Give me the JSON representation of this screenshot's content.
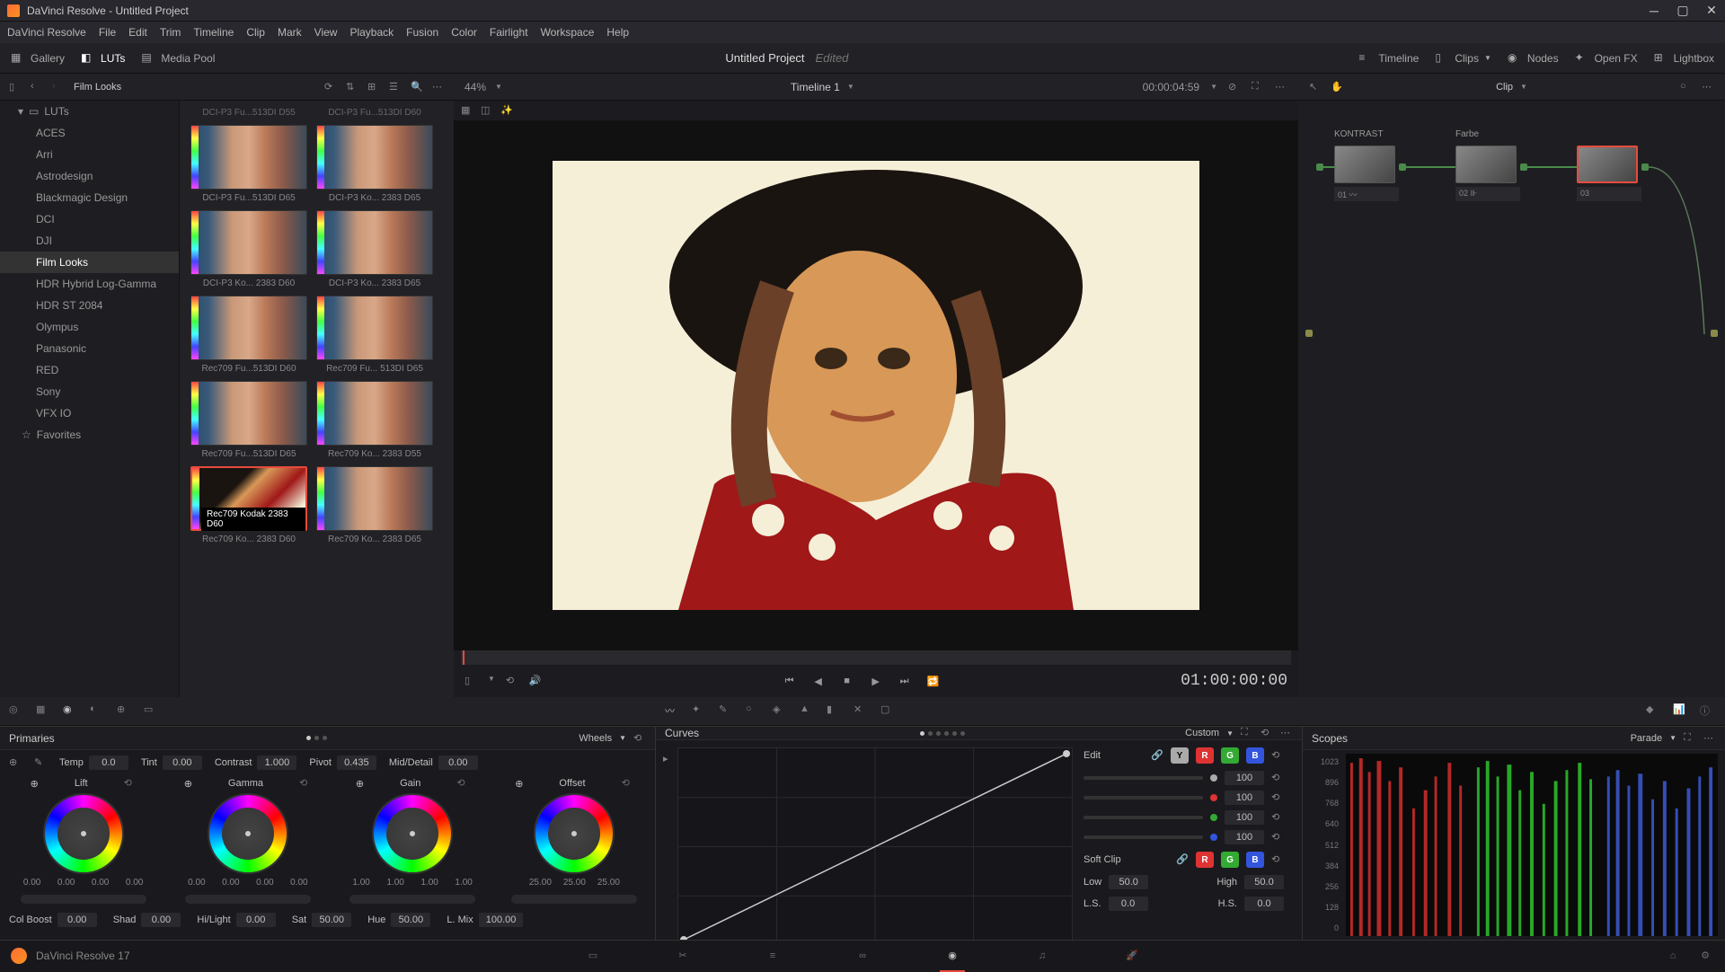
{
  "titlebar": {
    "text": "DaVinci Resolve - Untitled Project"
  },
  "menu": [
    "DaVinci Resolve",
    "File",
    "Edit",
    "Trim",
    "Timeline",
    "Clip",
    "Mark",
    "View",
    "Playback",
    "Fusion",
    "Color",
    "Fairlight",
    "Workspace",
    "Help"
  ],
  "toolbar": {
    "gallery": "Gallery",
    "luts": "LUTs",
    "mediapool": "Media Pool",
    "project_title": "Untitled Project",
    "project_status": "Edited",
    "timeline": "Timeline",
    "clips": "Clips",
    "nodes": "Nodes",
    "openfx": "Open FX",
    "lightbox": "Lightbox"
  },
  "toolbar2": {
    "panel_title": "Film Looks",
    "zoom": "44%",
    "timeline_name": "Timeline 1",
    "timecode": "00:00:04:59",
    "clip_label": "Clip"
  },
  "lut_tree": {
    "root": "LUTs",
    "items": [
      "ACES",
      "Arri",
      "Astrodesign",
      "Blackmagic Design",
      "DCI",
      "DJI",
      "Film Looks",
      "HDR Hybrid Log-Gamma",
      "HDR ST 2084",
      "Olympus",
      "Panasonic",
      "RED",
      "Sony",
      "VFX IO",
      "Favorites"
    ],
    "selected": "Film Looks"
  },
  "lut_thumbs": [
    {
      "l": "DCI-P3 Fu...513DI D65",
      "r": "DCI-P3 Ko... 2383 D65"
    },
    {
      "l": "DCI-P3 Ko... 2383 D60",
      "r": "DCI-P3 Ko... 2383 D65"
    },
    {
      "l": "Rec709 Fu...513DI D60",
      "r": "Rec709 Fu... 513DI D65"
    },
    {
      "l": "Rec709 Fu...513DI D65",
      "r": "Rec709 Ko... 2383 D55"
    },
    {
      "l": "Rec709 Ko... 2383 D60",
      "r": "Rec709 Ko... 2383 D65",
      "sel": true,
      "tooltip": "Rec709 Kodak 2383 D60"
    }
  ],
  "prev_row": {
    "l": "DCI-P3 Fu...513DI D55",
    "r": "DCI-P3 Fu...513DI D60"
  },
  "viewer": {
    "timecode": "01:00:00:00"
  },
  "nodes": {
    "n1": {
      "label": "KONTRAST",
      "num": "01"
    },
    "n2": {
      "label": "Farbe",
      "num": "02"
    },
    "n3": {
      "num": "03"
    }
  },
  "primaries": {
    "title": "Primaries",
    "mode": "Wheels",
    "temp": {
      "label": "Temp",
      "val": "0.0"
    },
    "tint": {
      "label": "Tint",
      "val": "0.00"
    },
    "contrast": {
      "label": "Contrast",
      "val": "1.000"
    },
    "pivot": {
      "label": "Pivot",
      "val": "0.435"
    },
    "middetail": {
      "label": "Mid/Detail",
      "val": "0.00"
    },
    "wheels": {
      "lift": {
        "label": "Lift",
        "vals": [
          "0.00",
          "0.00",
          "0.00",
          "0.00"
        ]
      },
      "gamma": {
        "label": "Gamma",
        "vals": [
          "0.00",
          "0.00",
          "0.00",
          "0.00"
        ]
      },
      "gain": {
        "label": "Gain",
        "vals": [
          "1.00",
          "1.00",
          "1.00",
          "1.00"
        ]
      },
      "offset": {
        "label": "Offset",
        "vals": [
          "25.00",
          "25.00",
          "25.00"
        ]
      }
    },
    "row2": {
      "colboost": {
        "label": "Col Boost",
        "val": "0.00"
      },
      "shad": {
        "label": "Shad",
        "val": "0.00"
      },
      "hilight": {
        "label": "Hi/Light",
        "val": "0.00"
      },
      "sat": {
        "label": "Sat",
        "val": "50.00"
      },
      "hue": {
        "label": "Hue",
        "val": "50.00"
      },
      "lmix": {
        "label": "L. Mix",
        "val": "100.00"
      }
    }
  },
  "curves": {
    "title": "Curves",
    "mode": "Custom",
    "edit": "Edit",
    "softclip": "Soft Clip",
    "vals": [
      "100",
      "100",
      "100",
      "100"
    ],
    "low": {
      "label": "Low",
      "val": "50.0"
    },
    "high": {
      "label": "High",
      "val": "50.0"
    },
    "ls": {
      "label": "L.S.",
      "val": "0.0"
    },
    "hs": {
      "label": "H.S.",
      "val": "0.0"
    }
  },
  "scopes": {
    "title": "Scopes",
    "mode": "Parade",
    "axis": [
      "1023",
      "896",
      "768",
      "640",
      "512",
      "384",
      "256",
      "128",
      "0"
    ]
  },
  "pagebar": {
    "app": "DaVinci Resolve 17"
  }
}
